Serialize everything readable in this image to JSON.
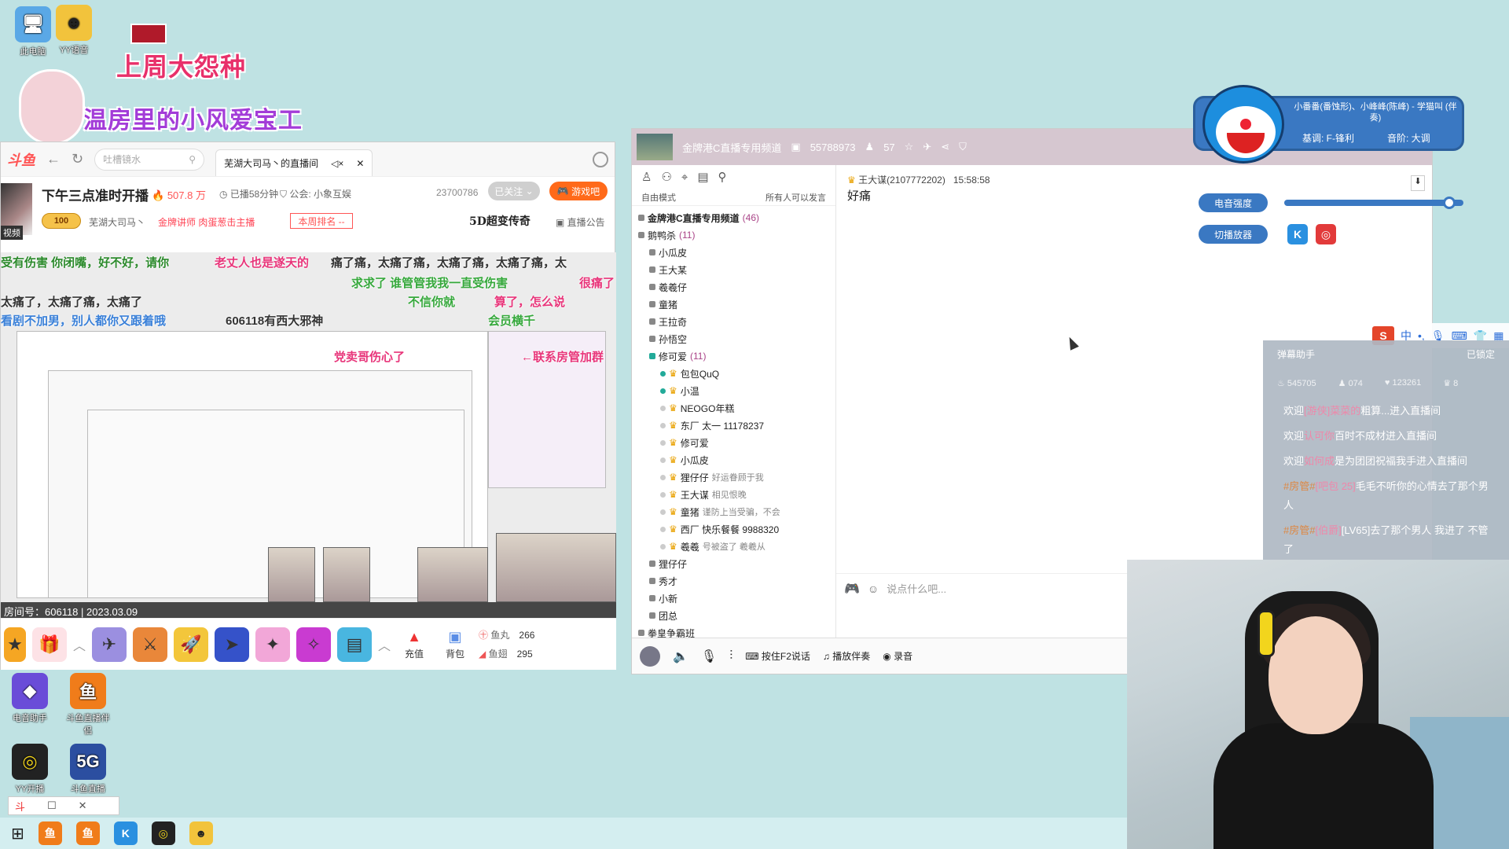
{
  "desktop": {
    "icons_top": [
      {
        "label": "此电脑",
        "name": "this-pc"
      },
      {
        "label": "YY语音",
        "name": "yy-voice"
      }
    ],
    "icons_bottom": [
      {
        "label": "电音助手",
        "name": "voice-assistant"
      },
      {
        "label": "斗鱼直播伴侣",
        "name": "douyu-companion"
      },
      {
        "label": "YY开播",
        "name": "yy-live"
      },
      {
        "label": "斗鱼直播",
        "name": "douyu-live"
      }
    ]
  },
  "overlay": {
    "banner1": "上周大怨种",
    "banner2": "温房里的小风爱宝工"
  },
  "browser": {
    "logo": "斗鱼",
    "search_placeholder": "吐槽镜水",
    "tab_title": "芜湖大司马丶的直播间",
    "room": {
      "title": "下午三点准时开播",
      "hot": "507.8 万",
      "live_time": "已播58分钟",
      "union": "公会: 小象互娱",
      "fans": "23700786",
      "follow": "已关注",
      "game": "游戏吧",
      "level": "100",
      "streamer": "芜湖大司马丶",
      "lecturer": "金牌讲师  肉蛋葱击主播",
      "rank": "本周排名 --",
      "chaos": "5D超变传奇",
      "announce": "直播公告",
      "side_label": "视频"
    },
    "danmu": [
      {
        "text": "受有伤害 你闭嘴，好不好，请你",
        "color": "#2c8a2c"
      },
      {
        "text": "老丈人也是遂天的",
        "color": "#e8357a"
      },
      {
        "text": "痛了痛，太痛了痛，太痛了痛，太痛了痛，太",
        "color": "#333333"
      },
      {
        "text": "求求了 谁管管我我一直受伤害",
        "color": "#36a83c"
      },
      {
        "text": "很痛了",
        "color": "#e8357a"
      },
      {
        "text": "太痛了，太痛了痛，太痛了",
        "color": "#333333"
      },
      {
        "text": "不信你就",
        "color": "#36a83c"
      },
      {
        "text": "算了，怎么说",
        "color": "#e8357a"
      },
      {
        "text": "看剧不加男，别人都你又跟着哦",
        "color": "#3a80d8"
      },
      {
        "text": "606118有西大邪神",
        "color": "#333333"
      },
      {
        "text": "会员横千",
        "color": "#36a83c"
      },
      {
        "text": "党卖哥伤心了",
        "color": "#e8357a"
      },
      {
        "text": "←联系房管加群",
        "color": "#e8357a"
      }
    ],
    "room_info": "房间号：606118 | 2023.03.09",
    "gift_controls": {
      "recharge": "充值",
      "backpack": "背包"
    },
    "wallet": {
      "yuwan_label": "鱼丸",
      "yuwan_value": "266",
      "yuchi_label": "鱼翅",
      "yuchi_value": "295"
    }
  },
  "voice_client": {
    "channel_name": "金牌港C直播专用频道",
    "channel_id": "55788973",
    "online": "57",
    "mode": "自由模式",
    "speak_rule": "所有人可以发言",
    "tree": [
      {
        "label": "金牌港C直播专用频道",
        "count": "(46)",
        "level": 0,
        "kind": "root"
      },
      {
        "label": "鹅鸭杀",
        "count": "(11)",
        "level": 0,
        "kind": "group"
      },
      {
        "label": "小瓜皮",
        "level": 1,
        "kind": "room"
      },
      {
        "label": "王大某",
        "level": 1,
        "kind": "room"
      },
      {
        "label": "羲羲仔",
        "level": 1,
        "kind": "room"
      },
      {
        "label": "童猪",
        "level": 1,
        "kind": "room"
      },
      {
        "label": "王拉奇",
        "level": 1,
        "kind": "room"
      },
      {
        "label": "孙悟空",
        "level": 1,
        "kind": "room"
      },
      {
        "label": "修可爱",
        "count": "(11)",
        "level": 1,
        "kind": "group"
      },
      {
        "label": "包包QuQ",
        "level": 2,
        "kind": "user",
        "online": true
      },
      {
        "label": "小温",
        "level": 2,
        "kind": "user",
        "online": true
      },
      {
        "label": "NEOGO年糕",
        "level": 2,
        "kind": "user"
      },
      {
        "label": "东厂 太一 11178237",
        "level": 2,
        "kind": "user"
      },
      {
        "label": "修可爱",
        "level": 2,
        "kind": "user"
      },
      {
        "label": "小瓜皮",
        "level": 2,
        "kind": "user"
      },
      {
        "label": "狸仔仔",
        "note": "好运眷顾于我",
        "level": 2,
        "kind": "user"
      },
      {
        "label": "王大谋",
        "note": "相见恨晚",
        "level": 2,
        "kind": "user"
      },
      {
        "label": "童猪",
        "note": "谨防上当受骗，不会",
        "level": 2,
        "kind": "user"
      },
      {
        "label": "西厂 快乐餐餐 9988320",
        "level": 2,
        "kind": "user"
      },
      {
        "label": "羲羲",
        "note": "号被盗了 羲羲从",
        "level": 2,
        "kind": "user"
      },
      {
        "label": "狸仔仔",
        "level": 1,
        "kind": "room"
      },
      {
        "label": "秀才",
        "level": 1,
        "kind": "room"
      },
      {
        "label": "小新",
        "level": 1,
        "kind": "room"
      },
      {
        "label": "团总",
        "level": 1,
        "kind": "room"
      },
      {
        "label": "拳皇争霸班",
        "level": 0,
        "kind": "group"
      }
    ],
    "message": {
      "sender": "王大谋(2107772202)",
      "time": "15:58:58",
      "text": "好痛"
    },
    "input_placeholder": "说点什么吧...",
    "bottom": {
      "ptt": "按住F2说话",
      "music": "播放伴奏",
      "record": "录音"
    }
  },
  "voice_changer": {
    "title": "小番番(番蚀形)、小峰峰(陈峰) - 学猫叫 (伴奏)",
    "key": "基调: F-锋利",
    "pitch": "音阶: 大调",
    "strength_label": "电音强度",
    "strength_value": 0.92,
    "player_label": "切播放器"
  },
  "danmu_assistant": {
    "title": "弹幕助手",
    "locked": "已锁定",
    "stats": [
      "545705",
      "074",
      "123261",
      "8"
    ],
    "lines": [
      {
        "pre": "欢迎",
        "user": "[游侠]菜菜的",
        "mid": "粗算...",
        "post": "进入直播间"
      },
      {
        "pre": "欢迎",
        "user": "认可你",
        "mid": "百时不成材",
        "post": "进入直播间"
      },
      {
        "pre": "欢迎",
        "user": "如何成",
        "mid": "是为团团祝福我手",
        "post": "进入直播间"
      },
      {
        "pre": "#房管#",
        "user": "[吧包 25]",
        "mid": "毛毛不听你的心情",
        "post": "去了那个男人"
      },
      {
        "pre": "#房管#",
        "user": "[伯爵]",
        "mid": "[LV65]",
        "post": "去了那个男人 我进了 不管了"
      }
    ]
  },
  "ime": {
    "lang": "中",
    "logo": "S"
  },
  "mini_window": {
    "label": "斗"
  }
}
